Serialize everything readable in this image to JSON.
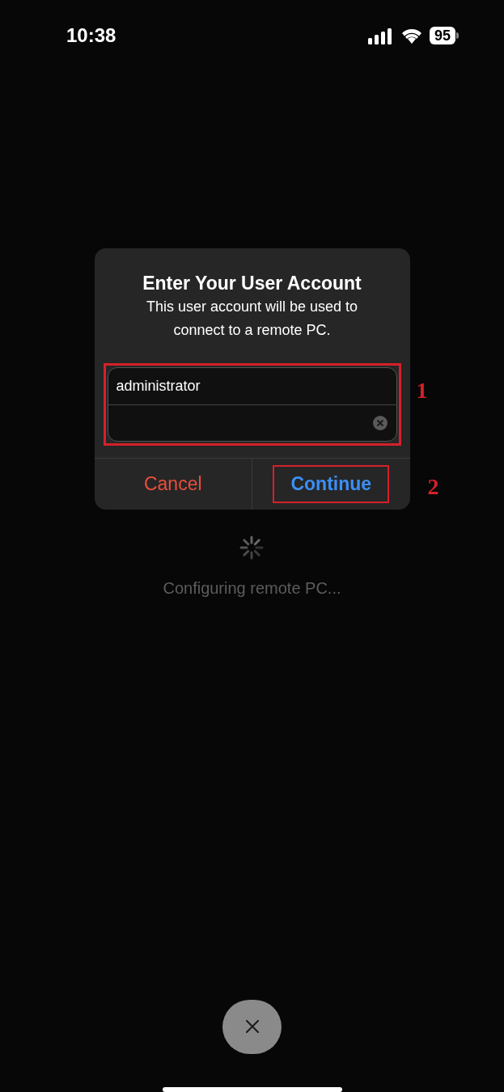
{
  "status_bar": {
    "time": "10:38",
    "battery": "95"
  },
  "dialog": {
    "title": "Enter Your User Account",
    "message": "This user account will be used to connect to a remote PC.",
    "fields": [
      {
        "value": "administrator",
        "clear_button": false
      },
      {
        "clear_button": true
      }
    ],
    "fields_annotation": "1",
    "buttons": [
      {
        "label": "Cancel",
        "kind": "destructive"
      },
      {
        "label": "Continue",
        "kind": "primary",
        "annotation": "2"
      }
    ]
  },
  "status": {
    "text": "Configuring remote PC..."
  }
}
